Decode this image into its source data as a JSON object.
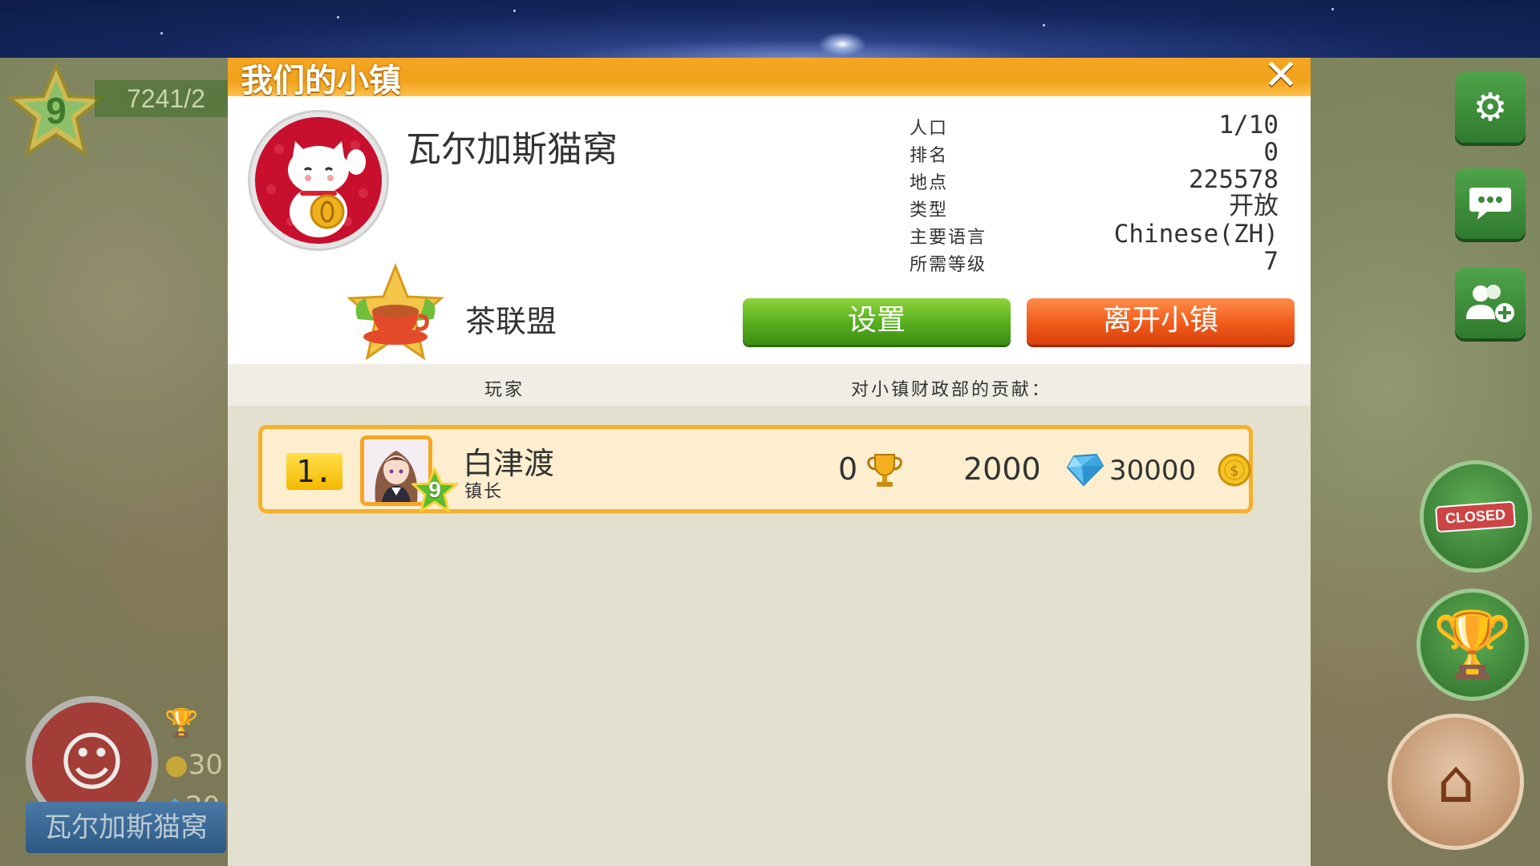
{
  "hud": {
    "player_level": "9",
    "xp_text": "7241/2",
    "town_stat_coins": "30",
    "town_stat_gems": "20",
    "town_banner": "瓦尔加斯猫窝",
    "closed_label": "CLOSED"
  },
  "modal": {
    "title": "我们的小镇",
    "town": {
      "name": "瓦尔加斯猫窝",
      "stats": [
        {
          "label": "人口",
          "value": "1/10"
        },
        {
          "label": "排名",
          "value": "0"
        },
        {
          "label": "地点",
          "value": "225578"
        },
        {
          "label": "类型",
          "value": "开放"
        },
        {
          "label": "主要语言",
          "value": "Chinese(ZH)"
        },
        {
          "label": "所需等级",
          "value": "7"
        }
      ],
      "league": "茶联盟"
    },
    "buttons": {
      "settings": "设置",
      "leave": "离开小镇"
    },
    "columns": {
      "player": "玩家",
      "contribution": "对小镇财政部的贡献："
    },
    "members": [
      {
        "rank": "1.",
        "name": "白津渡",
        "role": "镇长",
        "level": "9",
        "trophies": "0",
        "gems": "2000",
        "coins": "30000"
      }
    ]
  },
  "icons": {
    "trophy": "trophy-icon",
    "gem": "diamond-icon",
    "coin": "coin-icon",
    "settings": "gear-icon",
    "chat": "chat-icon",
    "add_friend": "add-friend-icon",
    "close": "close-icon"
  },
  "colors": {
    "header_orange": "#f5a623",
    "settings_green": "#55ad1f",
    "leave_red": "#f05a1a",
    "row_highlight": "#fceecf",
    "row_border": "#f6b02a"
  }
}
